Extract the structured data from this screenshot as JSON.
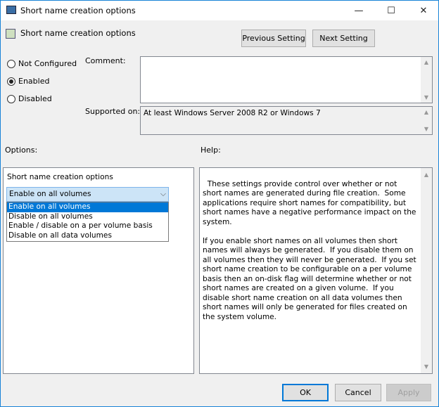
{
  "window": {
    "title": "Short name creation options",
    "minimize_icon": "—",
    "maximize_icon": "☐",
    "close_icon": "✕"
  },
  "header": {
    "setting_name": "Short name creation options",
    "previous_setting": "Previous Setting",
    "next_setting": "Next Setting"
  },
  "state": {
    "options": [
      "Not Configured",
      "Enabled",
      "Disabled"
    ],
    "selected": "Enabled"
  },
  "comment": {
    "label": "Comment:",
    "value": ""
  },
  "supported": {
    "label": "Supported on:",
    "value": "At least Windows Server 2008 R2 or Windows 7"
  },
  "options": {
    "label": "Options:",
    "field_label": "Short name creation options",
    "selected": "Enable on all volumes",
    "items": [
      "Enable on all volumes",
      "Disable on all volumes",
      "Enable / disable on a per volume basis",
      "Disable on all data volumes"
    ]
  },
  "help": {
    "label": "Help:",
    "text": "These settings provide control over whether or not short names are generated during file creation.  Some applications require short names for compatibility, but short names have a negative performance impact on the system.\n\nIf you enable short names on all volumes then short names will always be generated.  If you disable them on all volumes then they will never be generated.  If you set short name creation to be configurable on a per volume basis then an on-disk flag will determine whether or not short names are created on a given volume.  If you disable short name creation on all data volumes then short names will only be generated for files created on the system volume."
  },
  "footer": {
    "ok": "OK",
    "cancel": "Cancel",
    "apply": "Apply"
  }
}
